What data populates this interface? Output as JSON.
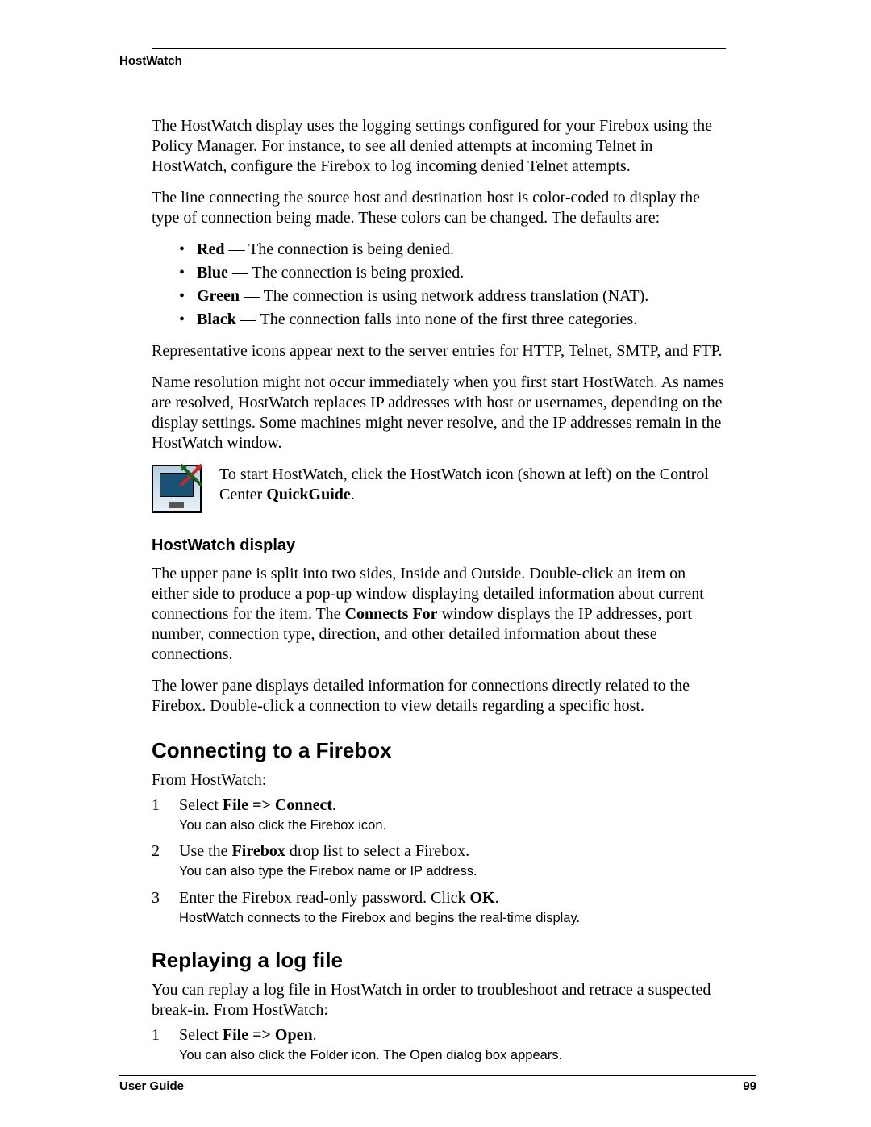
{
  "runningHead": "HostWatch",
  "p1": "The HostWatch display uses the logging settings configured for your Firebox using the Policy Manager. For instance, to see all denied attempts at incoming Telnet in HostWatch, configure the Firebox to log incoming denied Telnet attempts.",
  "p2": "The line connecting the source host and destination host is color-coded to display the type of connection being made. These colors can be changed. The defaults are:",
  "bullets": [
    {
      "label": "Red",
      "text": " — The connection is being denied."
    },
    {
      "label": "Blue",
      "text": " — The connection is being proxied."
    },
    {
      "label": "Green",
      "text": " — The connection is using network address translation (NAT)."
    },
    {
      "label": "Black",
      "text": " — The connection falls into none of the first three categories."
    }
  ],
  "p3": "Representative icons appear next to the server entries for HTTP, Telnet, SMTP, and FTP.",
  "p4": "Name resolution might not occur immediately when you first start HostWatch. As names are resolved, HostWatch replaces IP addresses with host or usernames, depending on the display settings. Some machines might never resolve, and the IP addresses remain in the HostWatch window.",
  "iconPara": {
    "pre": "To start HostWatch, click the HostWatch icon (shown at left) on the Control Center ",
    "bold": "QuickGuide",
    "post": "."
  },
  "sub1": "HostWatch display",
  "p5a": "The upper pane is split into two sides, Inside and Outside. Double-click an item on either side to produce a pop-up window displaying detailed information about current connections for the item. The ",
  "p5bold": "Connects For",
  "p5b": " window displays the IP addresses, port number, connection type, direction, and other detailed information about these connections.",
  "p6": "The lower pane displays detailed information for connections directly related to the Firebox. Double-click a connection to view details regarding a specific host.",
  "h2a": "Connecting to a Firebox",
  "p7": "From HostWatch:",
  "steps1": [
    {
      "num": "1",
      "pre": "Select ",
      "b1": "File ",
      "arrow": "=>",
      "b2": " Connect",
      "post": ".",
      "note": "You can also click the Firebox icon."
    },
    {
      "num": "2",
      "pre": "Use the ",
      "b1": "Firebox",
      "arrow": "",
      "b2": "",
      "post": " drop list to select a Firebox.",
      "note": "You can also type the Firebox name or IP address."
    },
    {
      "num": "3",
      "pre": "Enter the Firebox read-only password. Click ",
      "b1": "OK",
      "arrow": "",
      "b2": "",
      "post": ".",
      "note": "HostWatch connects to the Firebox and begins the real-time display."
    }
  ],
  "h2b": "Replaying a log file",
  "p8": "You can replay a log file in HostWatch in order to troubleshoot and retrace a suspected break-in. From HostWatch:",
  "steps2": [
    {
      "num": "1",
      "pre": "Select ",
      "b1": "File ",
      "arrow": "=>",
      "b2": " Open",
      "post": ".",
      "note": "You can also click the Folder icon. The Open dialog box appears."
    }
  ],
  "footer": {
    "left": "User Guide",
    "right": "99"
  }
}
